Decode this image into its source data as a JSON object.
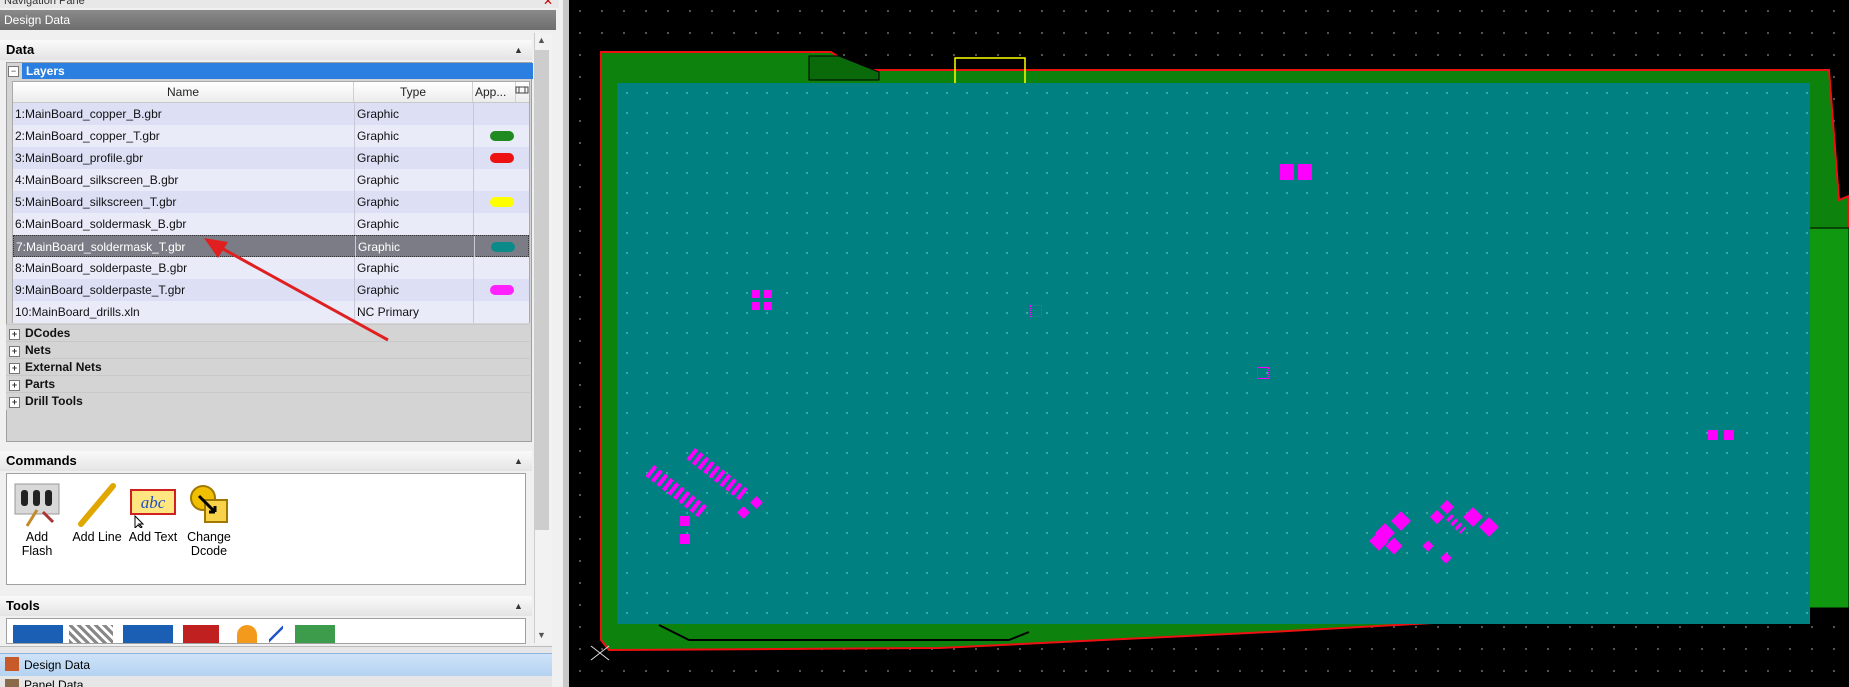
{
  "nav_pane": {
    "title": "Navigation Pane"
  },
  "design_data_bar": {
    "title": "Design Data"
  },
  "data_section": {
    "title": "Data"
  },
  "layers": {
    "label": "Layers",
    "columns": {
      "name": "Name",
      "type": "Type",
      "appearance": "App..."
    },
    "rows": [
      {
        "name": "1:MainBoard_copper_B.gbr",
        "type": "Graphic",
        "color": ""
      },
      {
        "name": "2:MainBoard_copper_T.gbr",
        "type": "Graphic",
        "color": "#1f8a1f"
      },
      {
        "name": "3:MainBoard_profile.gbr",
        "type": "Graphic",
        "color": "#ee1111"
      },
      {
        "name": "4:MainBoard_silkscreen_B.gbr",
        "type": "Graphic",
        "color": ""
      },
      {
        "name": "5:MainBoard_silkscreen_T.gbr",
        "type": "Graphic",
        "color": "#ffff00"
      },
      {
        "name": "6:MainBoard_soldermask_B.gbr",
        "type": "Graphic",
        "color": ""
      },
      {
        "name": "7:MainBoard_soldermask_T.gbr",
        "type": "Graphic",
        "color": "#0b8a8a"
      },
      {
        "name": "8:MainBoard_solderpaste_B.gbr",
        "type": "Graphic",
        "color": ""
      },
      {
        "name": "9:MainBoard_solderpaste_T.gbr",
        "type": "Graphic",
        "color": "#ff22ff"
      },
      {
        "name": "10:MainBoard_drills.xln",
        "type": "NC Primary",
        "color": ""
      }
    ],
    "selected_index": 6
  },
  "tree": [
    "DCodes",
    "Nets",
    "External Nets",
    "Parts",
    "Drill Tools"
  ],
  "commands": {
    "title": "Commands",
    "items": [
      {
        "label": "Add Flash",
        "icon": "add-flash-icon"
      },
      {
        "label": "Add Line",
        "icon": "add-line-icon"
      },
      {
        "label": "Add Text",
        "icon": "add-text-icon"
      },
      {
        "label": "Change Dcode",
        "icon": "change-dcode-icon"
      }
    ]
  },
  "tools": {
    "title": "Tools"
  },
  "footer": {
    "design_data": "Design Data",
    "panel_data": "Panel Data"
  },
  "colors": {
    "board_teal": "#008080",
    "board_green": "#1a8a1a",
    "pad_magenta": "#ff00ff",
    "profile_red": "#ee1111",
    "selection_blue": "#2a7fe0"
  }
}
